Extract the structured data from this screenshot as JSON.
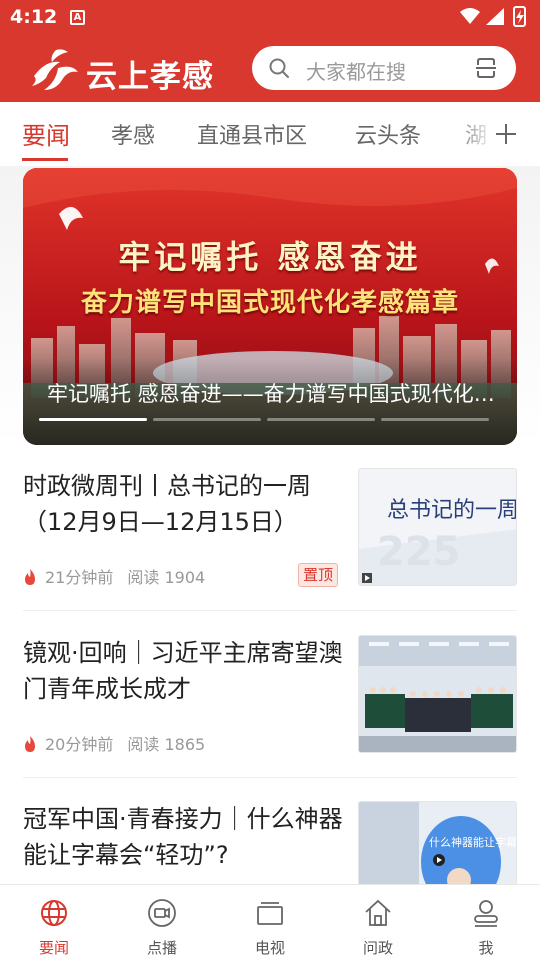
{
  "status_bar": {
    "time": "4:12",
    "notif_letter": "A"
  },
  "header": {
    "app_name": "云上孝感",
    "search_placeholder": "大家都在搜"
  },
  "tabs": [
    {
      "label": "要闻",
      "active": true
    },
    {
      "label": "孝感"
    },
    {
      "label": "直通县市区"
    },
    {
      "label": "云头条"
    },
    {
      "label": "湖"
    }
  ],
  "banner": {
    "line1": "牢记嘱托  感恩奋进",
    "line2": "奋力谱写中国式现代化孝感篇章",
    "caption": "牢记嘱托 感恩奋进——奋力谱写中国式现代化孝感篇章",
    "slide_count": 4,
    "active_slide": 1
  },
  "news": [
    {
      "title": "时政微周刊丨总书记的一周（12月9日—12月15日）",
      "time": "21分钟前",
      "reads": "阅读 1904",
      "pinned": true,
      "pin_label": "置顶",
      "thumb_text": "总书记的一周"
    },
    {
      "title": "镜观·回响｜习近平主席寄望澳门青年成长成才",
      "time": "20分钟前",
      "reads": "阅读 1865",
      "pinned": false
    },
    {
      "title": "冠军中国·青春接力｜什么神器能让字幕会“轻功”?",
      "thumb_text": "什么神器能让字幕会"
    }
  ],
  "bottom_nav": [
    {
      "label": "要闻",
      "icon": "globe-icon",
      "active": true
    },
    {
      "label": "点播",
      "icon": "video-camera-icon"
    },
    {
      "label": "电视",
      "icon": "tv-icon"
    },
    {
      "label": "问政",
      "icon": "home-icon"
    },
    {
      "label": "我",
      "icon": "person-icon"
    }
  ],
  "colors": {
    "brand_red": "#d9382e",
    "text_gray": "#999999"
  }
}
